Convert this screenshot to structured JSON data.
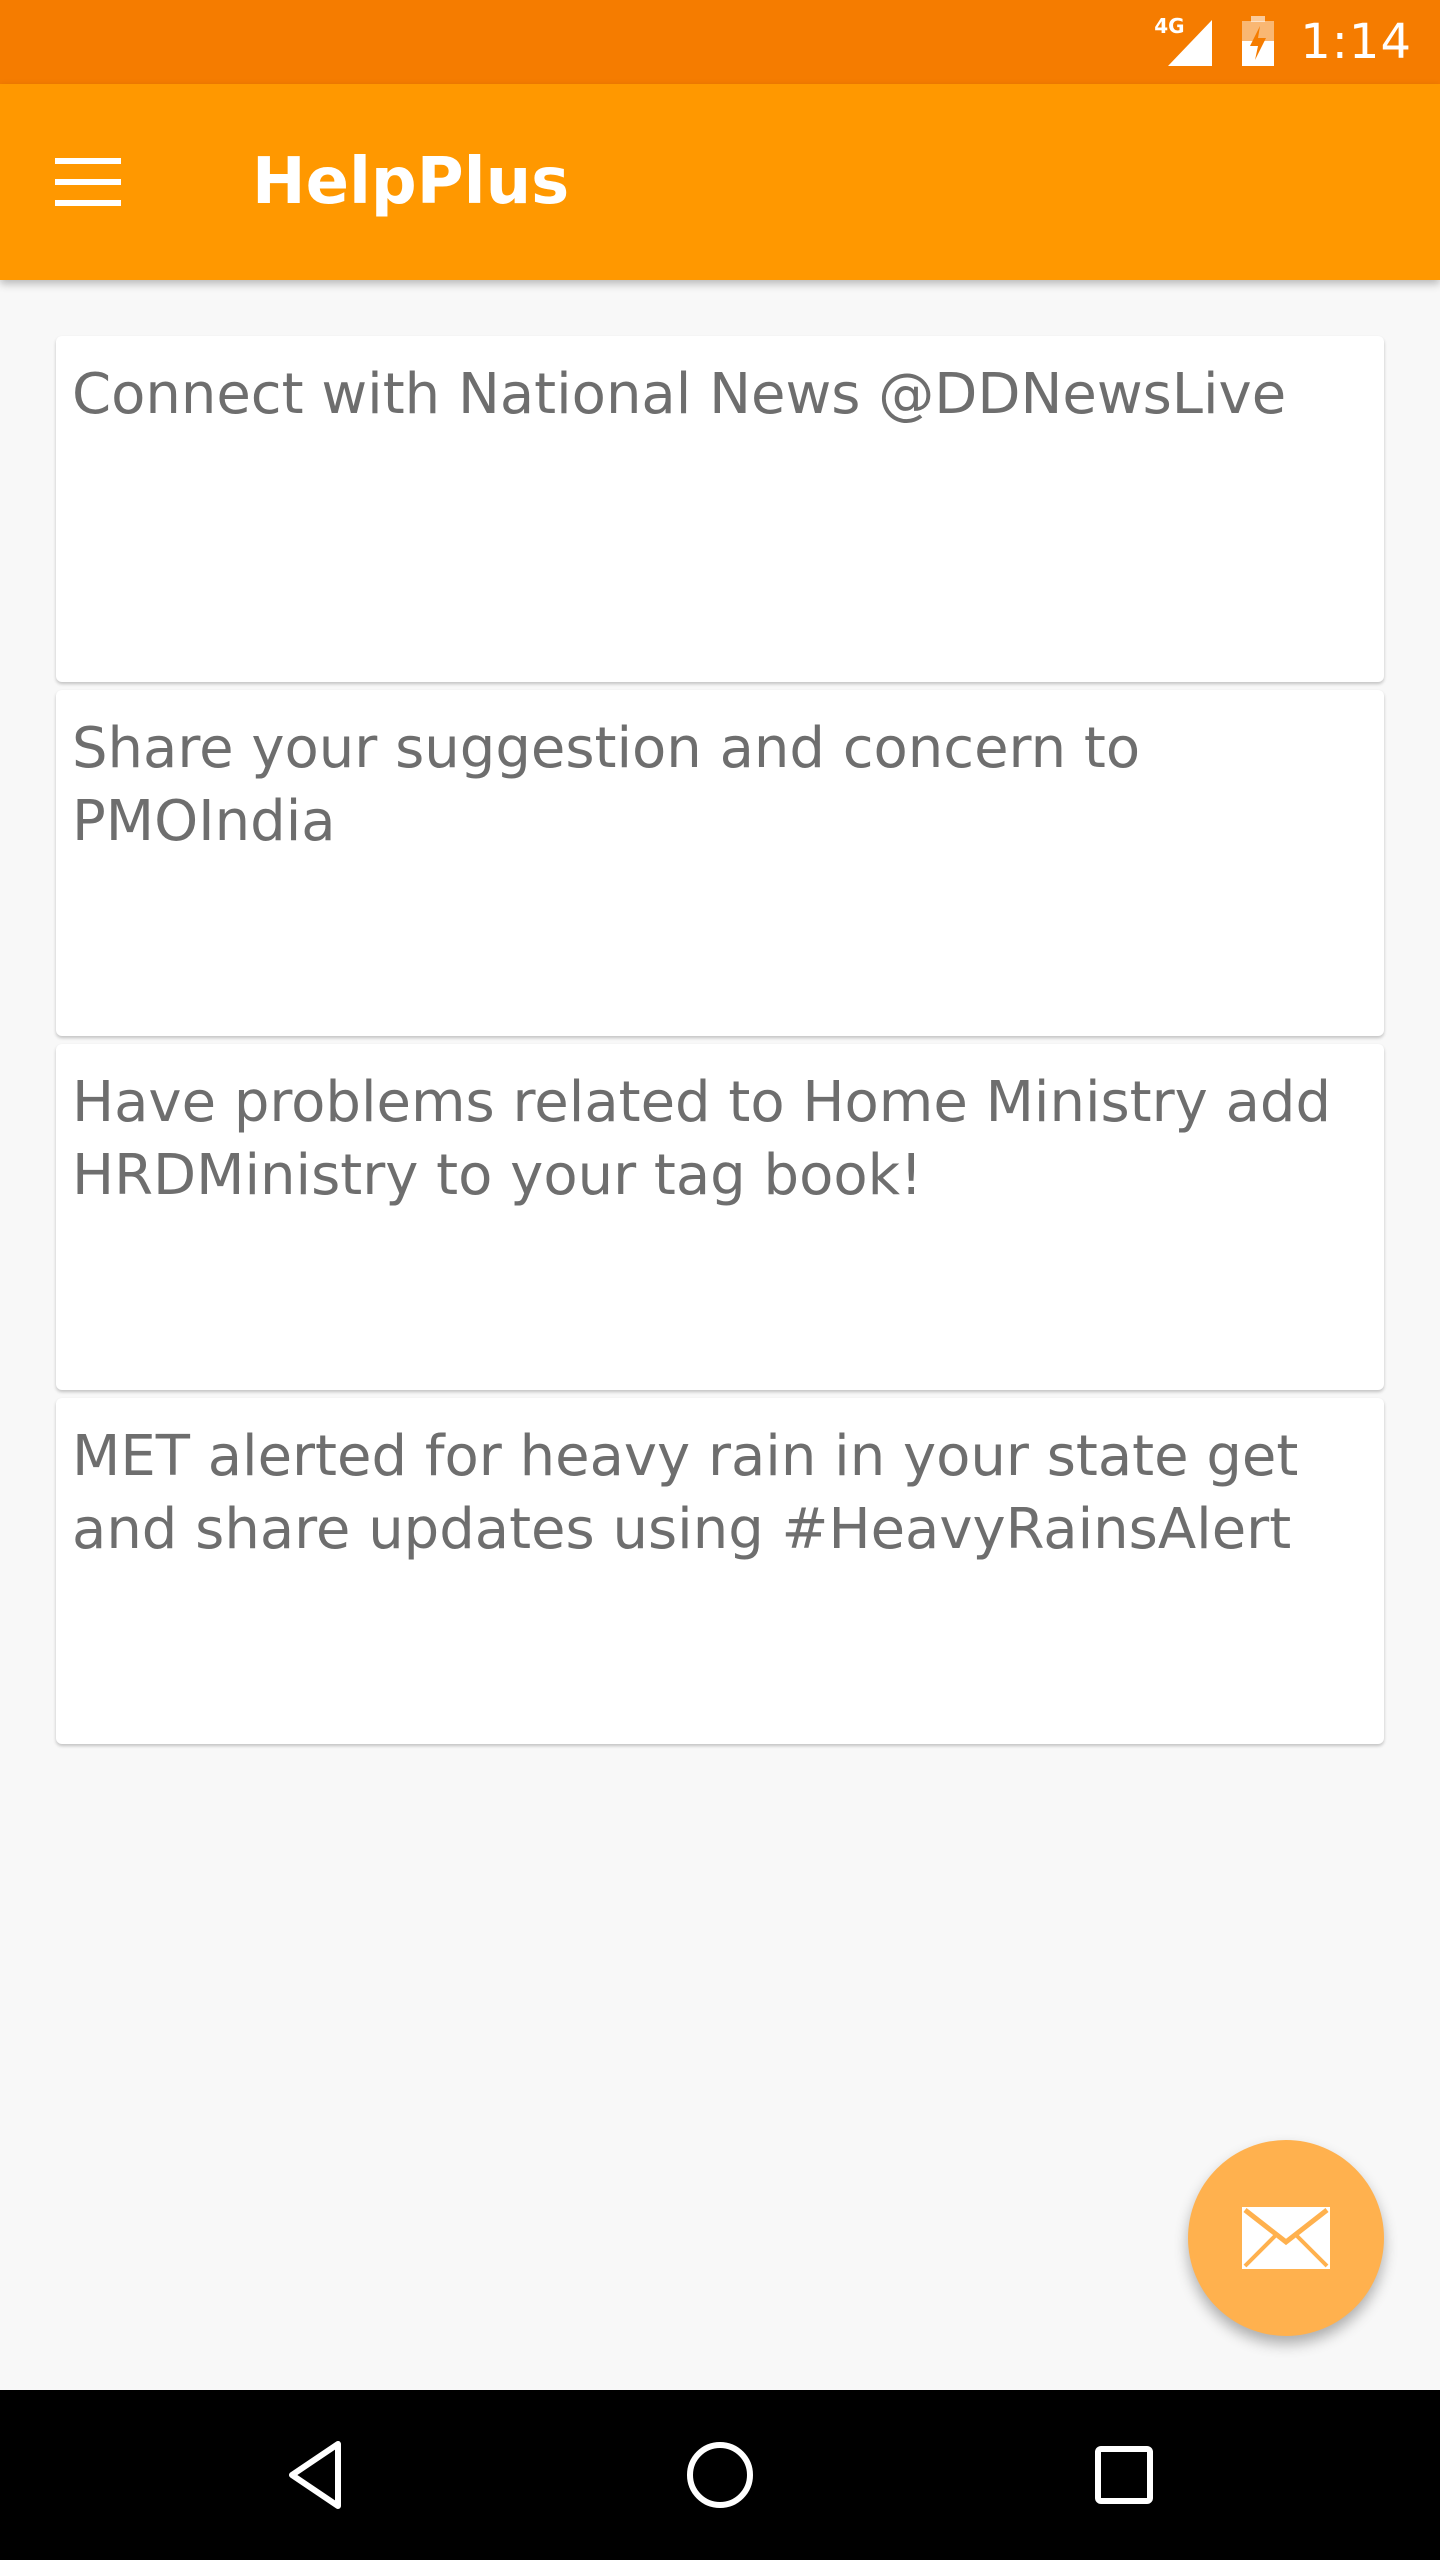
{
  "status_bar": {
    "network": "4G",
    "time": "1:14"
  },
  "app_bar": {
    "title": "HelpPlus",
    "menu_icon": "hamburger-menu-icon"
  },
  "cards": [
    {
      "text": "Connect with National News @DDNewsLive"
    },
    {
      "text": "Share your suggestion and concern to PMOIndia"
    },
    {
      "text": "Have problems related to Home Ministry add HRDMinistry to your tag book!"
    },
    {
      "text": "MET alerted for heavy rain in your state get and share updates using #HeavyRainsAlert"
    }
  ],
  "fab": {
    "icon": "envelope-icon",
    "color": "#ffb14e"
  },
  "nav_bar": {
    "back_icon": "back-triangle-icon",
    "home_icon": "home-circle-icon",
    "recents_icon": "recents-square-icon"
  },
  "colors": {
    "status_bar": "#f57c00",
    "app_bar": "#ff9800",
    "card_text": "#6e6e6e"
  }
}
